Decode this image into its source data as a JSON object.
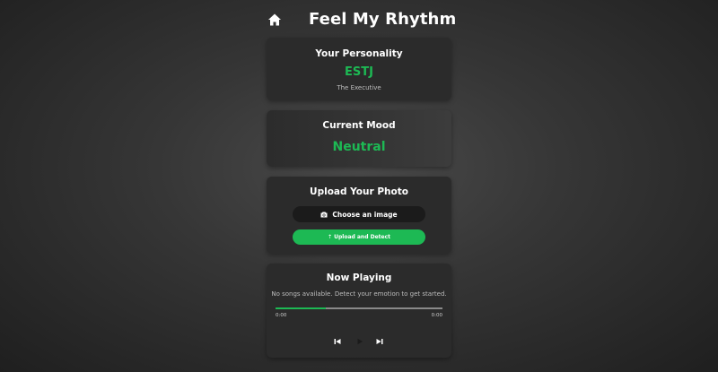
{
  "header": {
    "title": "Feel My Rhythm",
    "home_icon": "home-icon"
  },
  "personality": {
    "heading": "Your Personality",
    "type": "ESTJ",
    "description": "The Executive"
  },
  "mood": {
    "heading": "Current Mood",
    "value": "Neutral"
  },
  "upload": {
    "heading": "Upload Your Photo",
    "choose_label": "Choose an image",
    "choose_icon": "camera-icon",
    "upload_label": "⇡ Upload and Detect"
  },
  "player": {
    "heading": "Now Playing",
    "message": "No songs available. Detect your emotion to get started.",
    "current_time": "0:00",
    "total_time": "0:00",
    "progress_percent": 30,
    "controls": [
      "previous-icon",
      "play-icon",
      "next-icon"
    ]
  },
  "colors": {
    "accent": "#1db954",
    "card": "#2b2b2b",
    "button_dark": "#1b1b1b"
  }
}
